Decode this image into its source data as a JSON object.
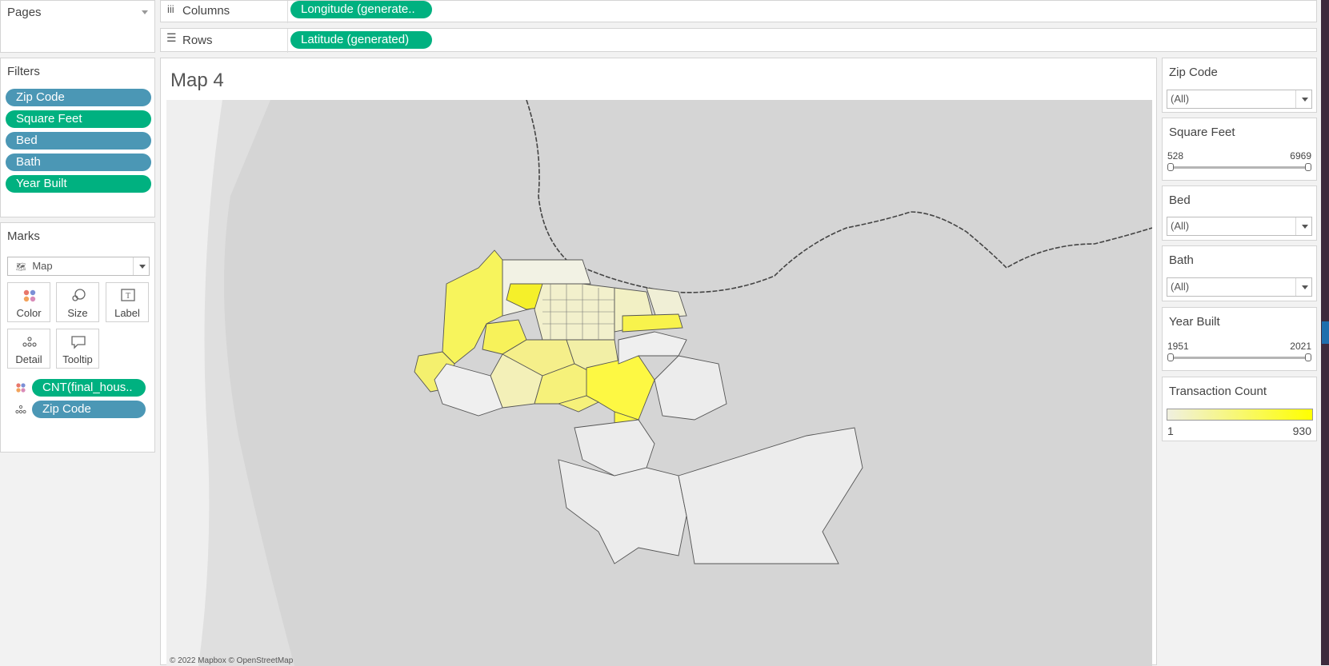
{
  "pages": {
    "label": "Pages"
  },
  "shelves": {
    "columns": {
      "label": "Columns",
      "pill": "Longitude (generate.."
    },
    "rows": {
      "label": "Rows",
      "pill": "Latitude (generated)"
    }
  },
  "filters": {
    "label": "Filters",
    "items": [
      "Zip Code",
      "Square Feet",
      "Bed",
      "Bath",
      "Year Built"
    ]
  },
  "marks": {
    "label": "Marks",
    "type": "Map",
    "buttons": [
      "Color",
      "Size",
      "Label",
      "Detail",
      "Tooltip"
    ],
    "fields": [
      "CNT(final_hous..",
      "Zip Code"
    ]
  },
  "view": {
    "title": "Map 4",
    "attribution": "© 2022 Mapbox © OpenStreetMap"
  },
  "quick_filters": {
    "zip_code": {
      "title": "Zip Code",
      "value": "(All)"
    },
    "square_feet": {
      "title": "Square Feet",
      "min": "528",
      "max": "6969"
    },
    "bed": {
      "title": "Bed",
      "value": "(All)"
    },
    "bath": {
      "title": "Bath",
      "value": "(All)"
    },
    "year_built": {
      "title": "Year Built",
      "min": "1951",
      "max": "2021"
    }
  },
  "legend": {
    "title": "Transaction Count",
    "min": "1",
    "max": "930",
    "color_low": "#f0f0e0",
    "color_high": "#ffff00"
  },
  "colors": {
    "pill_blue": "#4b97b5",
    "pill_green": "#00b180",
    "right_edge": "#3d2b3d",
    "accent_blue": "#1f6fae"
  }
}
